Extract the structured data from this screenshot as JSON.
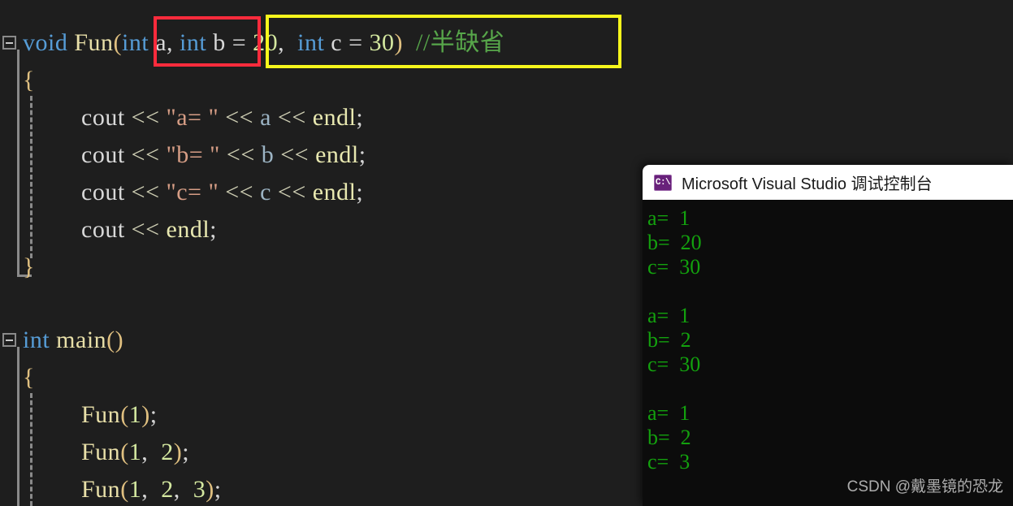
{
  "editor": {
    "background_color": "#1e1e1e",
    "lines": [
      {
        "id": "fn-signature",
        "segments": [
          {
            "cls": "kw",
            "text": "void"
          },
          {
            "cls": "plain",
            "text": " "
          },
          {
            "cls": "fn",
            "text": "Fun"
          },
          {
            "cls": "brace",
            "text": "("
          },
          {
            "cls": "kw",
            "text": "int"
          },
          {
            "cls": "plain",
            "text": " a, "
          },
          {
            "cls": "kw",
            "text": "int"
          },
          {
            "cls": "plain",
            "text": " b "
          },
          {
            "cls": "punct",
            "text": "= "
          },
          {
            "cls": "num",
            "text": "20"
          },
          {
            "cls": "plain",
            "text": ",  "
          },
          {
            "cls": "kw",
            "text": "int"
          },
          {
            "cls": "plain",
            "text": " c "
          },
          {
            "cls": "punct",
            "text": "= "
          },
          {
            "cls": "num",
            "text": "30"
          },
          {
            "cls": "brace",
            "text": ")"
          },
          {
            "cls": "plain",
            "text": "  "
          },
          {
            "cls": "cmt",
            "text": "//半缺省"
          }
        ]
      },
      {
        "id": "fn-open-brace",
        "segments": [
          {
            "cls": "brace",
            "text": "{"
          }
        ]
      },
      {
        "id": "cout-a",
        "segments": [
          {
            "cls": "plain",
            "text": "cout "
          },
          {
            "cls": "op",
            "text": "<< "
          },
          {
            "cls": "str",
            "text": "\"a= \""
          },
          {
            "cls": "plain",
            "text": " "
          },
          {
            "cls": "op",
            "text": "<< "
          },
          {
            "cls": "var",
            "text": "a "
          },
          {
            "cls": "op",
            "text": "<< "
          },
          {
            "cls": "endl",
            "text": "endl"
          },
          {
            "cls": "punct",
            "text": ";"
          }
        ]
      },
      {
        "id": "cout-b",
        "segments": [
          {
            "cls": "plain",
            "text": "cout "
          },
          {
            "cls": "op",
            "text": "<< "
          },
          {
            "cls": "str",
            "text": "\"b= \""
          },
          {
            "cls": "plain",
            "text": " "
          },
          {
            "cls": "op",
            "text": "<< "
          },
          {
            "cls": "var",
            "text": "b "
          },
          {
            "cls": "op",
            "text": "<< "
          },
          {
            "cls": "endl",
            "text": "endl"
          },
          {
            "cls": "punct",
            "text": ";"
          }
        ]
      },
      {
        "id": "cout-c",
        "segments": [
          {
            "cls": "plain",
            "text": "cout "
          },
          {
            "cls": "op",
            "text": "<< "
          },
          {
            "cls": "str",
            "text": "\"c= \""
          },
          {
            "cls": "plain",
            "text": " "
          },
          {
            "cls": "op",
            "text": "<< "
          },
          {
            "cls": "var",
            "text": "c "
          },
          {
            "cls": "op",
            "text": "<< "
          },
          {
            "cls": "endl",
            "text": "endl"
          },
          {
            "cls": "punct",
            "text": ";"
          }
        ]
      },
      {
        "id": "cout-endl",
        "segments": [
          {
            "cls": "plain",
            "text": "cout "
          },
          {
            "cls": "op",
            "text": "<< "
          },
          {
            "cls": "endl",
            "text": "endl"
          },
          {
            "cls": "punct",
            "text": ";"
          }
        ]
      },
      {
        "id": "fn-close-brace",
        "segments": [
          {
            "cls": "brace",
            "text": "}"
          }
        ]
      },
      {
        "id": "main-signature",
        "segments": [
          {
            "cls": "kw",
            "text": "int"
          },
          {
            "cls": "plain",
            "text": " "
          },
          {
            "cls": "fn",
            "text": "main"
          },
          {
            "cls": "brace",
            "text": "()"
          }
        ]
      },
      {
        "id": "main-open-brace",
        "segments": [
          {
            "cls": "brace",
            "text": "{"
          }
        ]
      },
      {
        "id": "call-fun-1",
        "segments": [
          {
            "cls": "fn",
            "text": "Fun"
          },
          {
            "cls": "brace",
            "text": "("
          },
          {
            "cls": "num",
            "text": "1"
          },
          {
            "cls": "brace",
            "text": ")"
          },
          {
            "cls": "punct",
            "text": ";"
          }
        ]
      },
      {
        "id": "call-fun-1-2",
        "segments": [
          {
            "cls": "fn",
            "text": "Fun"
          },
          {
            "cls": "brace",
            "text": "("
          },
          {
            "cls": "num",
            "text": "1"
          },
          {
            "cls": "plain",
            "text": ",  "
          },
          {
            "cls": "num",
            "text": "2"
          },
          {
            "cls": "brace",
            "text": ")"
          },
          {
            "cls": "punct",
            "text": ";"
          }
        ]
      },
      {
        "id": "call-fun-1-2-3",
        "segments": [
          {
            "cls": "fn",
            "text": "Fun"
          },
          {
            "cls": "brace",
            "text": "("
          },
          {
            "cls": "num",
            "text": "1"
          },
          {
            "cls": "plain",
            "text": ",  "
          },
          {
            "cls": "num",
            "text": "2"
          },
          {
            "cls": "plain",
            "text": ",  "
          },
          {
            "cls": "num",
            "text": "3"
          },
          {
            "cls": "brace",
            "text": ")"
          },
          {
            "cls": "punct",
            "text": ";"
          }
        ]
      }
    ],
    "annotations": [
      {
        "name": "red-highlight-box",
        "color": "#ff2b3c",
        "label": "int a,"
      },
      {
        "name": "yellow-highlight-box",
        "color": "#f7f71c",
        "label": "int b = 20,  int c = 30)"
      }
    ]
  },
  "console": {
    "title": "Microsoft Visual Studio 调试控制台",
    "icon_label": "C:\\",
    "icon_color": "#68217a",
    "text_color": "#13a10e",
    "background_color": "#0c0c0c",
    "lines": [
      "a=  1",
      "b=  20",
      "c=  30",
      "",
      "a=  1",
      "b=  2",
      "c=  30",
      "",
      "a=  1",
      "b=  2",
      "c=  3"
    ],
    "watermark": "CSDN @戴墨镜的恐龙"
  }
}
